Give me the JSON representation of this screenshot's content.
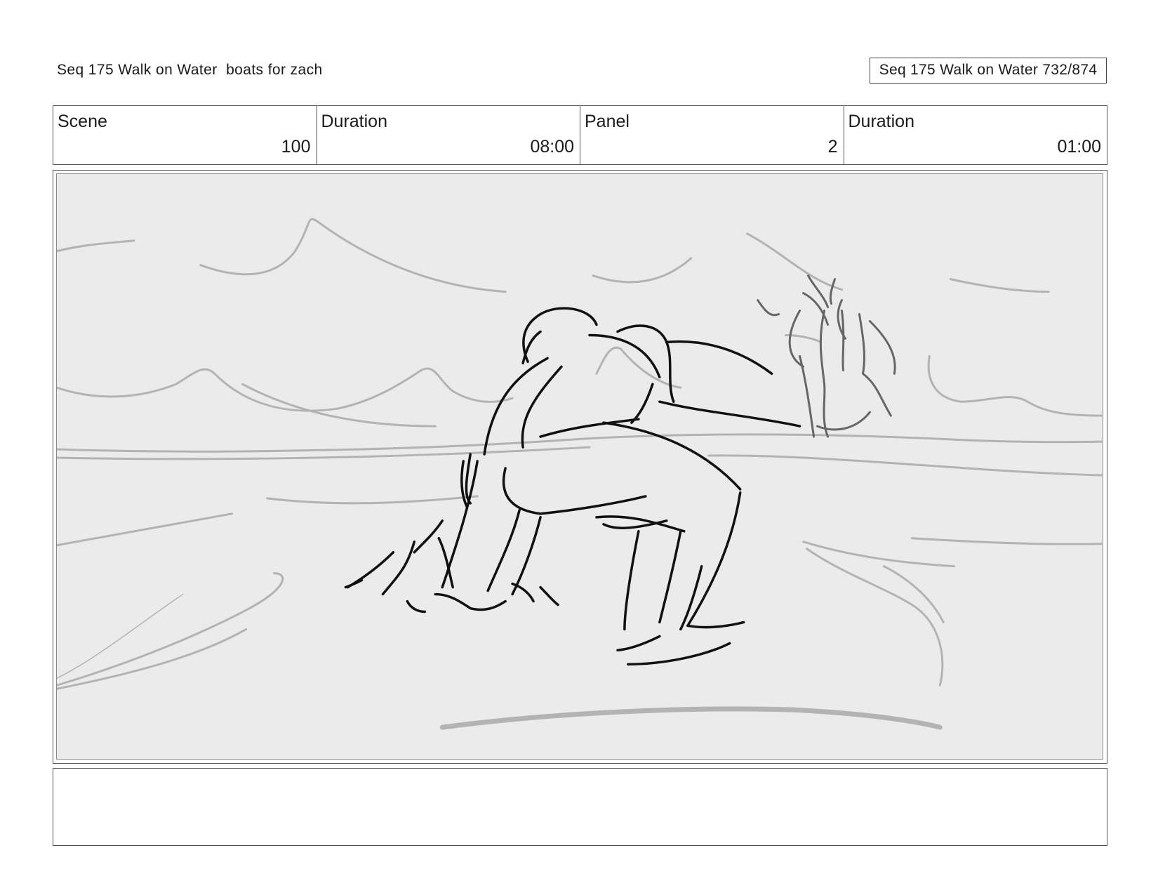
{
  "header": {
    "title": "Seq 175 Walk on Water  boats for zach",
    "page_label": "Seq 175 Walk on Water 732/874"
  },
  "info": {
    "scene_label": "Scene",
    "scene_value": "100",
    "scene_duration_label": "Duration",
    "scene_duration_value": "08:00",
    "panel_label": "Panel",
    "panel_value": "2",
    "panel_duration_label": "Duration",
    "panel_duration_value": "01:00"
  },
  "notes": {
    "text": ""
  }
}
